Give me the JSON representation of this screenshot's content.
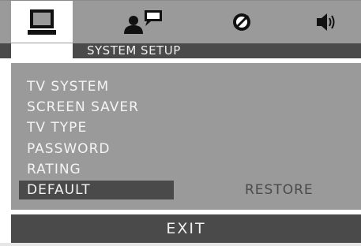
{
  "tabs": [
    {
      "icon": "monitor-icon",
      "active": true
    },
    {
      "icon": "person-speech-icon",
      "active": false
    },
    {
      "icon": "disc-slash-icon",
      "active": false
    },
    {
      "icon": "speaker-icon",
      "active": false
    }
  ],
  "header": {
    "title": "SYSTEM SETUP"
  },
  "menu": {
    "items": [
      {
        "label": "TV SYSTEM"
      },
      {
        "label": "SCREEN SAVER"
      },
      {
        "label": "TV TYPE"
      },
      {
        "label": "PASSWORD"
      },
      {
        "label": "RATING"
      },
      {
        "label": "DEFAULT",
        "selected": true
      }
    ],
    "selected_value": "RESTORE"
  },
  "footer": {
    "exit_label": "EXIT"
  },
  "colors": {
    "panel": "#9a9a9a",
    "highlight": "#4a4a4a",
    "text_light": "#f4f4f4",
    "text_dark": "#4a4a4a",
    "active_tab": "#ffffff"
  }
}
